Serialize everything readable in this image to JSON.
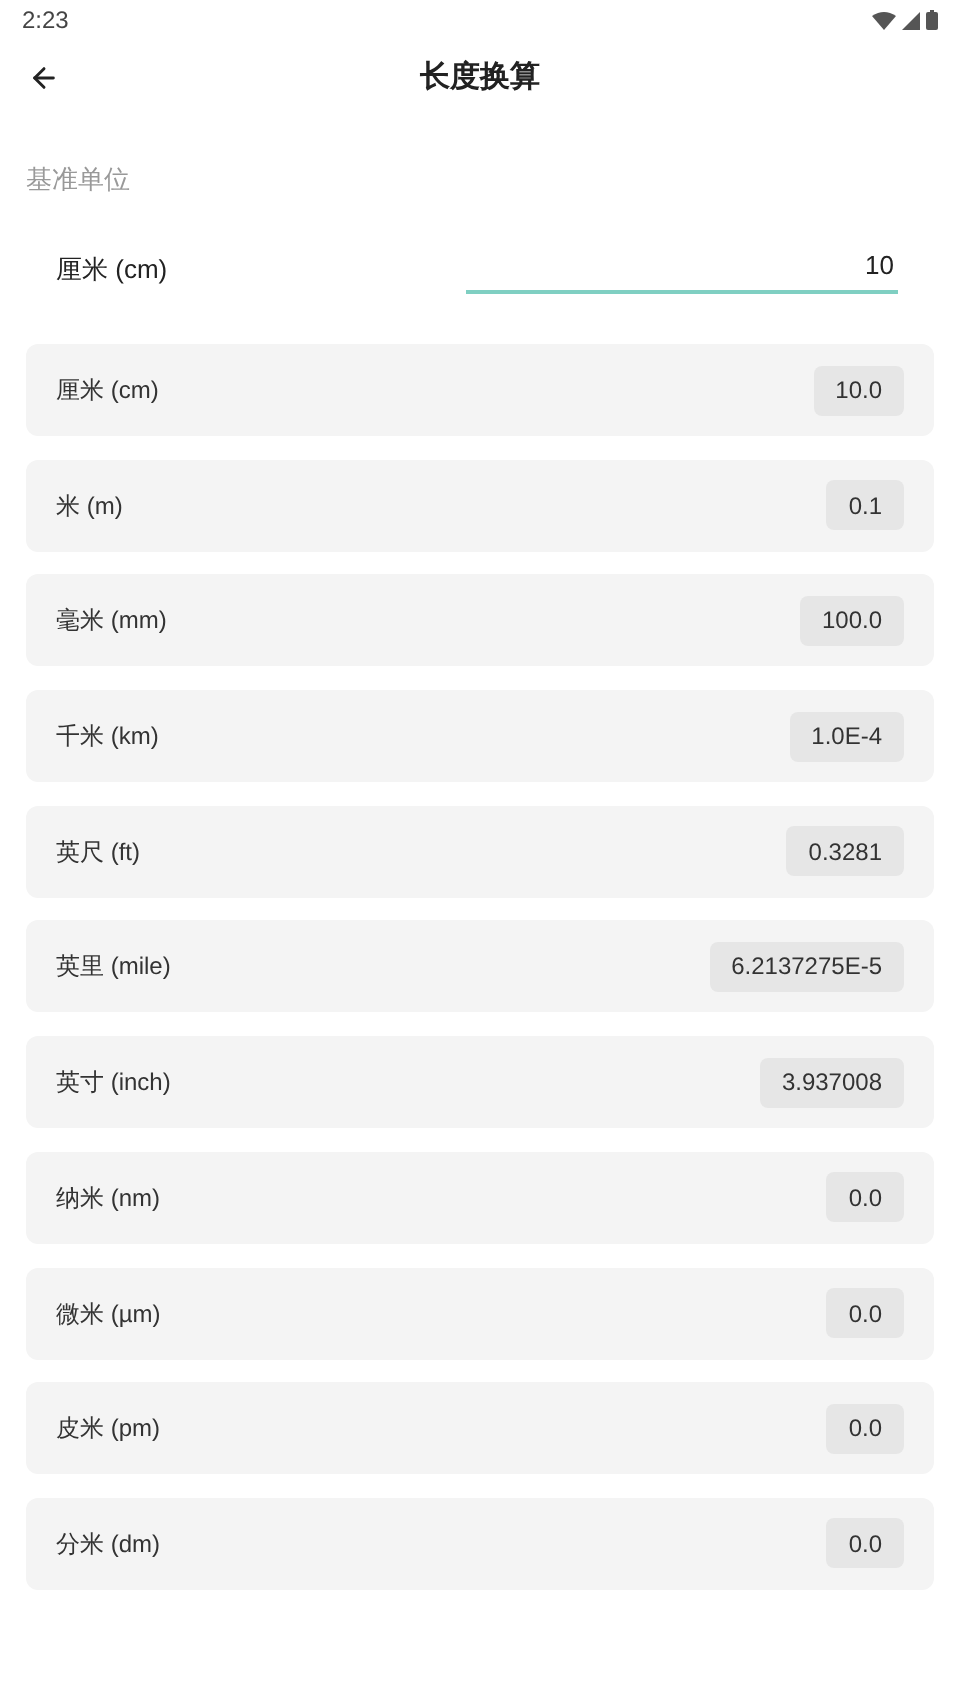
{
  "status_bar": {
    "time": "2:23"
  },
  "header": {
    "title": "长度换算"
  },
  "base": {
    "section_label": "基准单位",
    "unit": "厘米 (cm)",
    "value": "10"
  },
  "units": [
    {
      "name": "厘米 (cm)",
      "value": "10.0"
    },
    {
      "name": "米 (m)",
      "value": "0.1"
    },
    {
      "name": "毫米 (mm)",
      "value": "100.0"
    },
    {
      "name": "千米 (km)",
      "value": "1.0E-4"
    },
    {
      "name": "英尺 (ft)",
      "value": "0.3281"
    },
    {
      "name": "英里 (mile)",
      "value": "6.2137275E-5"
    },
    {
      "name": "英寸 (inch)",
      "value": "3.937008"
    },
    {
      "name": "纳米 (nm)",
      "value": "0.0"
    },
    {
      "name": "微米 (µm)",
      "value": "0.0"
    },
    {
      "name": "皮米 (pm)",
      "value": "0.0"
    },
    {
      "name": "分米 (dm)",
      "value": "0.0"
    }
  ]
}
